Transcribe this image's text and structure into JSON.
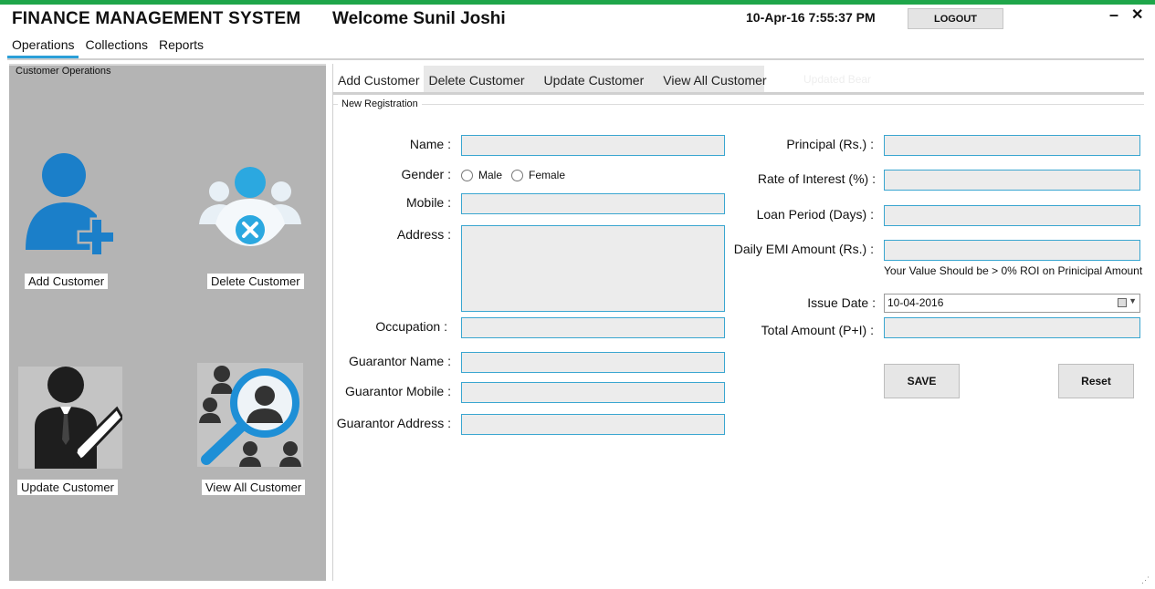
{
  "header": {
    "app_title": "FINANCE MANAGEMENT SYSTEM",
    "welcome": "Welcome Sunil Joshi",
    "datetime": "10-Apr-16 7:55:37 PM",
    "logout_label": "LOGOUT",
    "minimize_glyph": "–",
    "close_glyph": "✕"
  },
  "menu": {
    "items": [
      {
        "label": "Operations",
        "active": true
      },
      {
        "label": "Collections"
      },
      {
        "label": "Reports"
      }
    ]
  },
  "sidebar": {
    "title": "Customer Operations",
    "tiles": [
      {
        "label": "Add Customer",
        "icon": "add-user-icon"
      },
      {
        "label": "Delete Customer",
        "icon": "delete-users-icon"
      },
      {
        "label": "Update Customer",
        "icon": "edit-user-icon"
      },
      {
        "label": "View All Customer",
        "icon": "search-users-icon"
      }
    ]
  },
  "tabs": {
    "items": [
      {
        "label": "Add Customer",
        "active": true
      },
      {
        "label": "Delete Customer"
      },
      {
        "label": "Update Customer"
      },
      {
        "label": "View All Customer"
      }
    ],
    "ghost_label": "Updated Bear"
  },
  "form": {
    "group_title": "New Registration",
    "name_label": "Name :",
    "gender_label": "Gender :",
    "male_label": "Male",
    "female_label": "Female",
    "mobile_label": "Mobile :",
    "address_label": "Address :",
    "occupation_label": "Occupation :",
    "guarantor_name_label": "Guarantor Name :",
    "guarantor_mobile_label": "Guarantor Mobile :",
    "guarantor_address_label": "Guarantor Address :",
    "principal_label": "Principal (Rs.) :",
    "roi_label": "Rate of Interest (%) :",
    "loan_period_label": "Loan Period (Days) :",
    "emi_label": "Daily EMI Amount (Rs.) :",
    "roi_hint": "Your Value Should be > 0% ROI on Prinicipal Amount",
    "issue_date_label": "Issue Date :",
    "issue_date_value": "10-04-2016",
    "total_label": "Total Amount (P+I) :",
    "save_label": "SAVE",
    "reset_label": "Reset"
  },
  "colors": {
    "accent": "#2b9fd8",
    "top_bar": "#1fa64a",
    "side_panel": "#b4b4b4",
    "icon_blue": "#1b7fc9"
  }
}
